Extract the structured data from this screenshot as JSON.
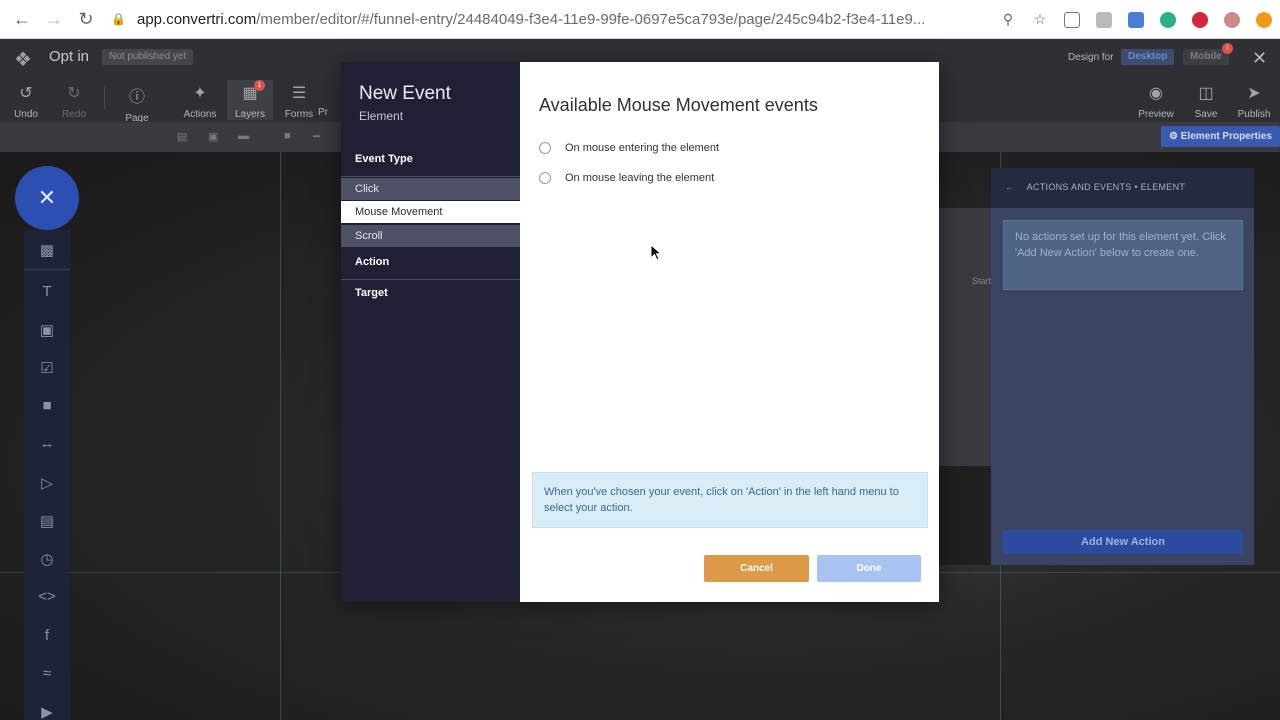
{
  "browser": {
    "url_host": "app.convertri.com",
    "url_path": "/member/editor/#/funnel-entry/24484049-f3e4-11e9-99fe-0697e5ca793e/page/245c94b2-f3e4-11e9..."
  },
  "app": {
    "page_title": "Opt in",
    "publish_status": "Not published yet",
    "design_for_label": "Design for",
    "desktop_label": "Desktop",
    "mobile_label": "Mobile",
    "mobile_badge": "!",
    "tools": {
      "undo": "Undo",
      "redo": "Redo",
      "page": "Page",
      "actions": "Actions",
      "layers": "Layers",
      "layers_badge": "1",
      "forms": "Forms",
      "pr": "Pr",
      "preview": "Preview",
      "save": "Save",
      "publish": "Publish"
    },
    "element_properties": "Element Properties"
  },
  "right_panel": {
    "header": "ACTIONS AND EVENTS • ELEMENT",
    "note": "No actions set up for this element yet. Click 'Add New Action' below to create one.",
    "add_action": "Add New Action",
    "start_fragment": "Start"
  },
  "modal": {
    "title": "New Event",
    "subtitle": "Element",
    "sections": {
      "event_type": "Event Type",
      "action": "Action",
      "target": "Target"
    },
    "event_types": [
      "Click",
      "Mouse Movement",
      "Scroll"
    ],
    "selected_event_type": "Mouse Movement",
    "heading": "Available Mouse Movement events",
    "options": [
      "On mouse entering the element",
      "On mouse leaving the element"
    ],
    "info": "When you've chosen your event, click on 'Action' in the left hand menu to select your action.",
    "cancel": "Cancel",
    "done": "Done"
  },
  "colors": {
    "modal_sidebar": "#1f2033",
    "cancel": "#dd9b47",
    "done_disabled": "#a8c3f2",
    "info_bg": "#d8edf5",
    "accent_blue": "#2b4fb3"
  }
}
